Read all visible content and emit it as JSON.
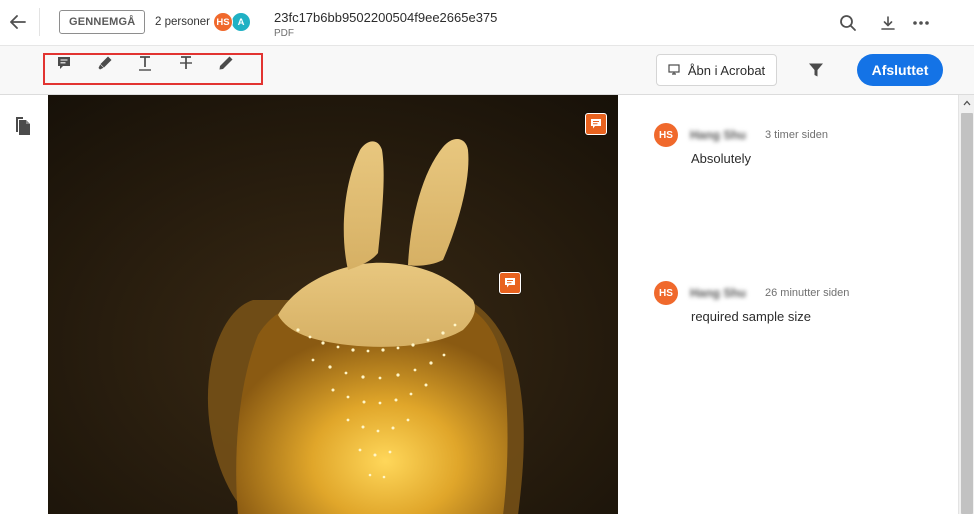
{
  "topbar": {
    "back_icon": "arrow-left-icon",
    "review_label": "GENNEMGÅ",
    "people_label": "2 personer",
    "avatars": [
      {
        "initials": "HS",
        "color": "#f0692c"
      },
      {
        "initials": "A",
        "color": "#20b1c4"
      }
    ],
    "file_name": "23fc17b6bb9502200504f9ee2665e375",
    "file_type": "PDF",
    "icons": [
      "search-icon",
      "download-icon",
      "more-icon"
    ]
  },
  "toolbar": {
    "tools": [
      {
        "name": "add-comment",
        "icon": "comment-icon"
      },
      {
        "name": "highlight",
        "icon": "highlighter-icon"
      },
      {
        "name": "underline-text",
        "icon": "underline-text-icon"
      },
      {
        "name": "strikethrough-text",
        "icon": "strikethrough-text-icon"
      },
      {
        "name": "draw",
        "icon": "pencil-icon"
      }
    ],
    "highlight_box_color": "#e23431",
    "open_acrobat_label": "Åbn i Acrobat",
    "filter_icon": "filter-icon",
    "done_label": "Afsluttet",
    "accent_color": "#1473e6"
  },
  "comments": [
    {
      "initials": "HS",
      "author": "Hang Shu",
      "time": "3 timer siden",
      "text": "Absolutely"
    },
    {
      "initials": "HS",
      "author": "Hang Shu",
      "time": "26 minutter siden",
      "text": "required sample size"
    }
  ]
}
